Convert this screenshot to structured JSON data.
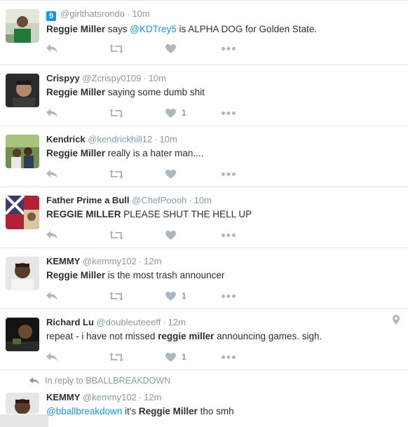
{
  "tweets": [
    {
      "fullname": "",
      "username": "@girlthatsrondo",
      "time": "10m",
      "badge": "9",
      "text_parts": [
        {
          "t": "Reggie Miller",
          "b": true
        },
        {
          "t": " says ",
          "b": false
        },
        {
          "t": "@KDTrey5",
          "m": true
        },
        {
          "t": " is ALPHA DOG for Golden State.",
          "b": false
        }
      ],
      "like_count": ""
    },
    {
      "fullname": "Crispyy",
      "username": "@Zcrispy0109",
      "time": "10m",
      "text_parts": [
        {
          "t": "Reggie Miller",
          "b": true
        },
        {
          "t": " saying some dumb shit",
          "b": false
        }
      ],
      "like_count": "1"
    },
    {
      "fullname": "Kendrick",
      "username": "@kendrickhill12",
      "time": "10m",
      "text_parts": [
        {
          "t": "Reggie Miller",
          "b": true
        },
        {
          "t": " really is a hater man....",
          "b": false
        }
      ],
      "like_count": ""
    },
    {
      "fullname": "Father Prime a Bull",
      "username": "@ChefPoooh",
      "time": "10m",
      "text_parts": [
        {
          "t": "REGGIE MILLER",
          "b": true
        },
        {
          "t": " PLEASE SHUT THE HELL UP",
          "b": false
        }
      ],
      "like_count": ""
    },
    {
      "fullname": "KEMMY",
      "username": "@kemmy102",
      "time": "12m",
      "text_parts": [
        {
          "t": "Reggie Miller",
          "b": true
        },
        {
          "t": " is the most trash announcer",
          "b": false
        }
      ],
      "like_count": "1"
    },
    {
      "fullname": "Richard Lu",
      "username": "@doubleuteeeff",
      "time": "12m",
      "text_parts": [
        {
          "t": "repeat - i have not missed ",
          "b": false
        },
        {
          "t": "reggie miller",
          "b": true
        },
        {
          "t": " announcing games. sigh.",
          "b": false
        }
      ],
      "like_count": "1"
    }
  ],
  "reply_tweet": {
    "in_reply_to": "In reply to BBALLBREAKDOWN",
    "fullname": "KEMMY",
    "username": "@kemmy102",
    "time": "12m",
    "mention": "@bballbreakdown",
    "text_mid": " it's ",
    "bold": "Reggie Miller",
    "text_end": " tho smh"
  },
  "colors": {
    "icon_grey": "#aab8c2",
    "link_blue": "#1b95e0"
  },
  "icons": [
    "reply-icon",
    "retweet-icon",
    "like-icon",
    "more-icon",
    "location-pin-icon"
  ]
}
